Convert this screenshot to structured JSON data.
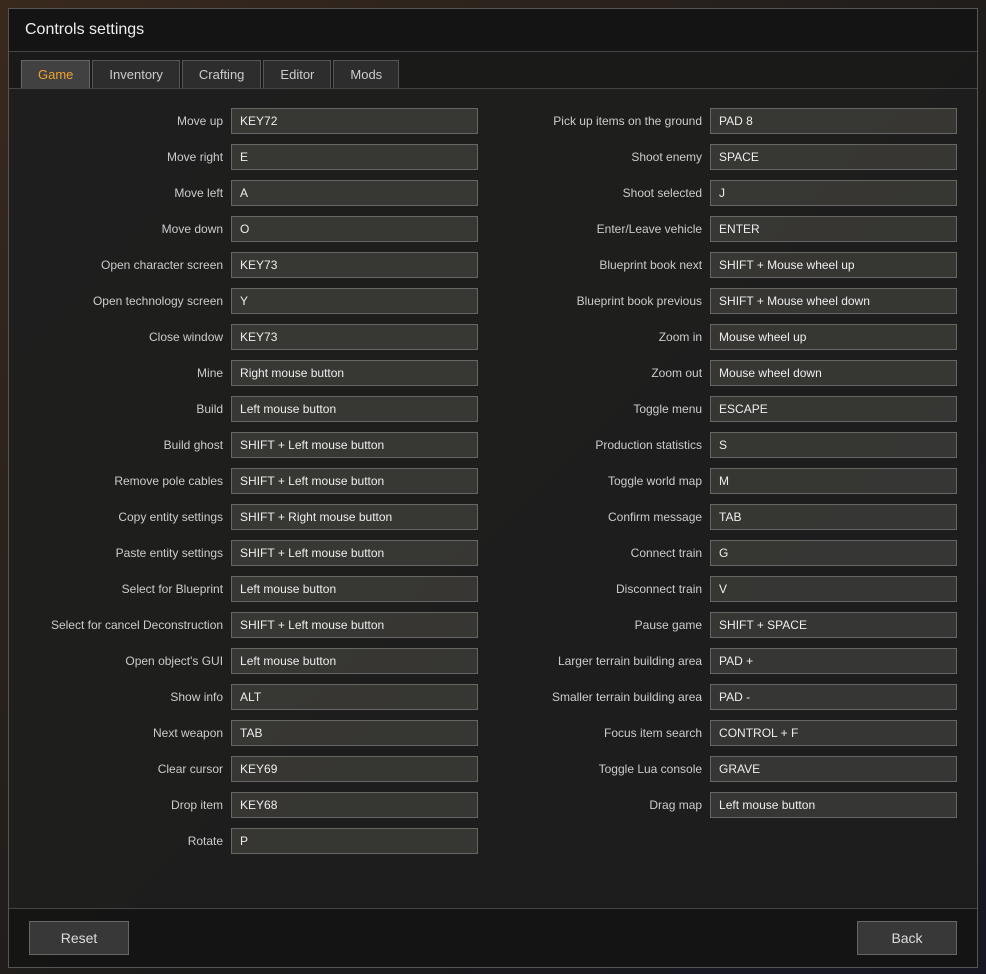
{
  "title": "Controls settings",
  "tabs": [
    {
      "label": "Game",
      "active": true
    },
    {
      "label": "Inventory",
      "active": false
    },
    {
      "label": "Crafting",
      "active": false
    },
    {
      "label": "Editor",
      "active": false
    },
    {
      "label": "Mods",
      "active": false
    }
  ],
  "left_controls": [
    {
      "label": "Move up",
      "value": "KEY72"
    },
    {
      "label": "Move right",
      "value": "E"
    },
    {
      "label": "Move left",
      "value": "A"
    },
    {
      "label": "Move down",
      "value": "O"
    },
    {
      "label": "Open character screen",
      "value": "KEY73"
    },
    {
      "label": "Open technology screen",
      "value": "Y"
    },
    {
      "label": "Close window",
      "value": "KEY73"
    },
    {
      "label": "Mine",
      "value": "Right mouse button"
    },
    {
      "label": "Build",
      "value": "Left mouse button"
    },
    {
      "label": "Build ghost",
      "value": "SHIFT + Left mouse button"
    },
    {
      "label": "Remove pole cables",
      "value": "SHIFT + Left mouse button"
    },
    {
      "label": "Copy entity settings",
      "value": "SHIFT + Right mouse button"
    },
    {
      "label": "Paste entity settings",
      "value": "SHIFT + Left mouse button"
    },
    {
      "label": "Select for Blueprint",
      "value": "Left mouse button"
    },
    {
      "label": "Select for cancel Deconstruction",
      "value": "SHIFT + Left mouse button"
    },
    {
      "label": "Open object's GUI",
      "value": "Left mouse button"
    },
    {
      "label": "Show info",
      "value": "ALT"
    },
    {
      "label": "Next weapon",
      "value": "TAB"
    },
    {
      "label": "Clear cursor",
      "value": "KEY69"
    },
    {
      "label": "Drop item",
      "value": "KEY68"
    },
    {
      "label": "Rotate",
      "value": "P"
    }
  ],
  "right_controls": [
    {
      "label": "Pick up items on the ground",
      "value": "PAD 8"
    },
    {
      "label": "Shoot enemy",
      "value": "SPACE"
    },
    {
      "label": "Shoot selected",
      "value": "J"
    },
    {
      "label": "Enter/Leave vehicle",
      "value": "ENTER"
    },
    {
      "label": "Blueprint book next",
      "value": "SHIFT + Mouse wheel up"
    },
    {
      "label": "Blueprint book previous",
      "value": "SHIFT + Mouse wheel down"
    },
    {
      "label": "Zoom in",
      "value": "Mouse wheel up"
    },
    {
      "label": "Zoom out",
      "value": "Mouse wheel down"
    },
    {
      "label": "Toggle menu",
      "value": "ESCAPE"
    },
    {
      "label": "Production statistics",
      "value": "S"
    },
    {
      "label": "Toggle world map",
      "value": "M"
    },
    {
      "label": "Confirm message",
      "value": "TAB"
    },
    {
      "label": "Connect train",
      "value": "G"
    },
    {
      "label": "Disconnect train",
      "value": "V"
    },
    {
      "label": "Pause game",
      "value": "SHIFT + SPACE"
    },
    {
      "label": "Larger terrain building area",
      "value": "PAD +"
    },
    {
      "label": "Smaller terrain building area",
      "value": "PAD -"
    },
    {
      "label": "Focus item search",
      "value": "CONTROL + F"
    },
    {
      "label": "Toggle Lua console",
      "value": "GRAVE"
    },
    {
      "label": "Drag map",
      "value": "Left mouse button"
    }
  ],
  "footer": {
    "reset_label": "Reset",
    "back_label": "Back"
  }
}
